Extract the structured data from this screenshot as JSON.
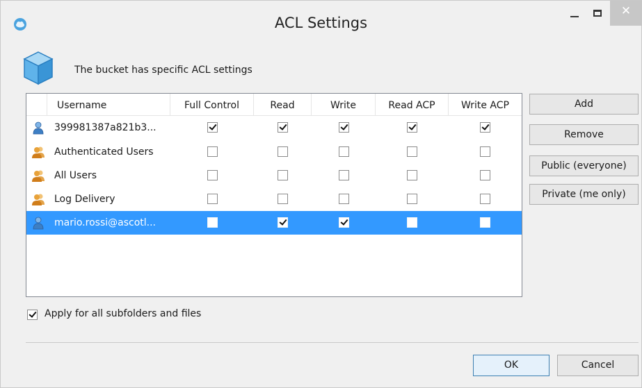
{
  "window": {
    "title": "ACL Settings",
    "close_glyph": "✕"
  },
  "header": {
    "text": "The bucket has specific ACL settings"
  },
  "grid": {
    "columns": [
      "Username",
      "Full Control",
      "Read",
      "Write",
      "Read ACP",
      "Write ACP"
    ],
    "rows": [
      {
        "username": "399981387a821b3...",
        "icon": "user-icon-blue",
        "perms": [
          true,
          true,
          true,
          true,
          true
        ],
        "selected": false
      },
      {
        "username": "Authenticated Users",
        "icon": "group-icon",
        "perms": [
          false,
          false,
          false,
          false,
          false
        ],
        "selected": false
      },
      {
        "username": "All Users",
        "icon": "group-icon",
        "perms": [
          false,
          false,
          false,
          false,
          false
        ],
        "selected": false
      },
      {
        "username": "Log Delivery",
        "icon": "group-icon",
        "perms": [
          false,
          false,
          false,
          false,
          false
        ],
        "selected": false
      },
      {
        "username": "mario.rossi@ascotl...",
        "icon": "user-icon-blue",
        "perms": [
          false,
          true,
          true,
          false,
          false
        ],
        "selected": true
      }
    ]
  },
  "side_buttons": {
    "add": "Add",
    "remove": "Remove",
    "public": "Public (everyone)",
    "private": "Private (me only)"
  },
  "apply": {
    "label": "Apply for all subfolders and files",
    "checked": true
  },
  "footer": {
    "ok": "OK",
    "cancel": "Cancel"
  },
  "colors": {
    "selection": "#3399ff",
    "window_bg": "#f0f0f0"
  }
}
